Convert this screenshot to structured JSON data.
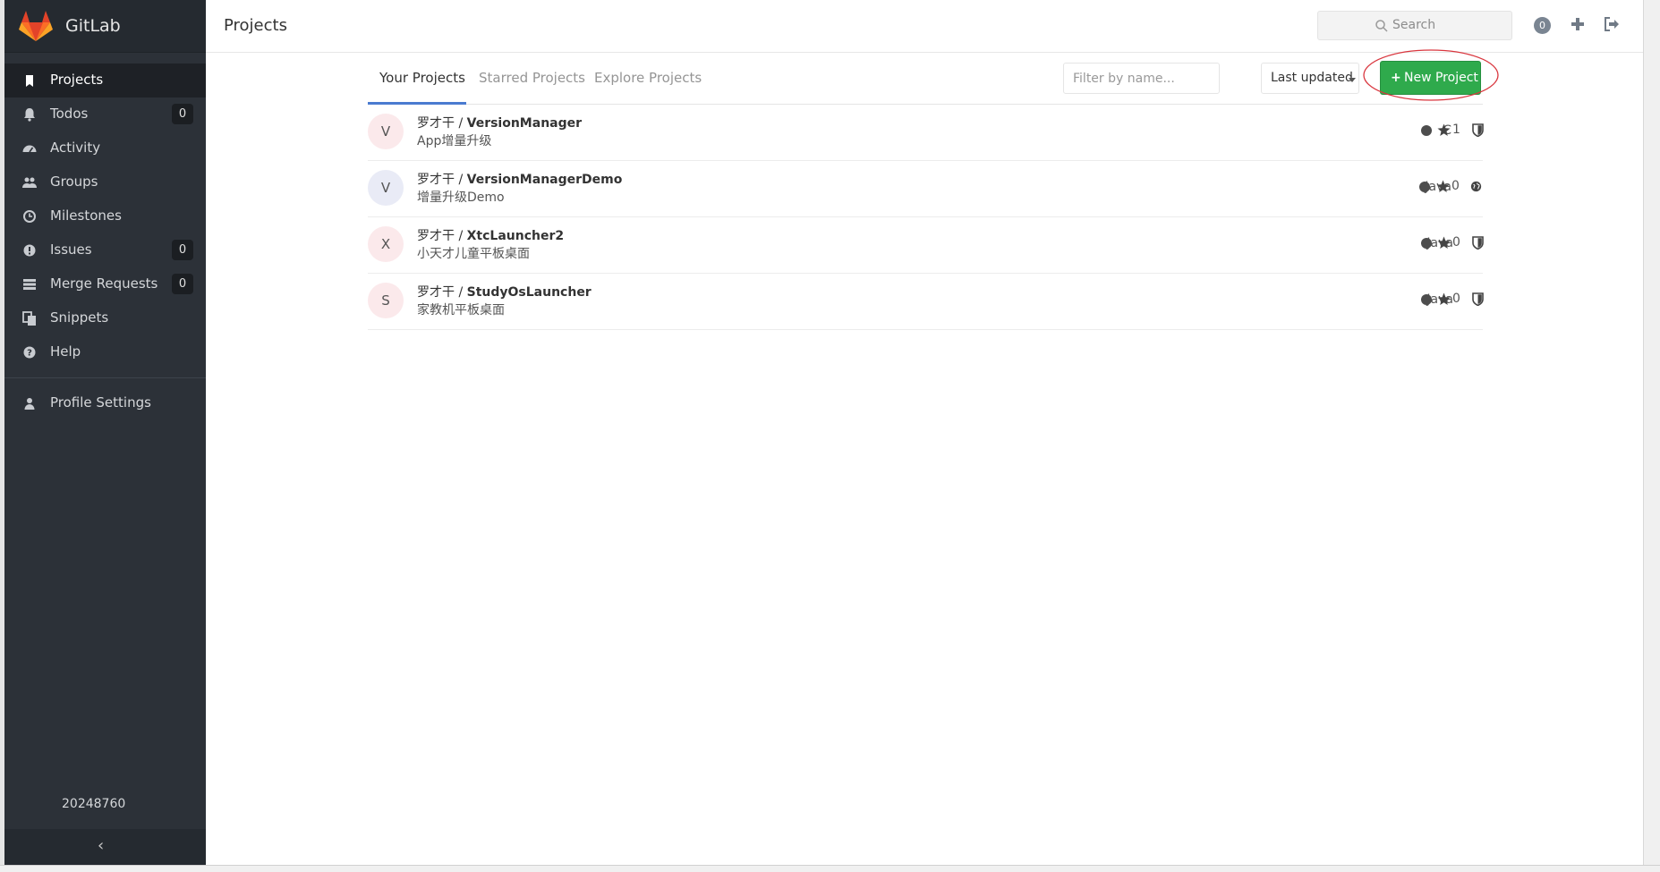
{
  "app": {
    "name": "GitLab"
  },
  "sidebar": {
    "items": [
      {
        "label": "Projects",
        "icon": "bookmark-icon",
        "active": true
      },
      {
        "label": "Todos",
        "icon": "bell-icon",
        "badge": "0"
      },
      {
        "label": "Activity",
        "icon": "dashboard-icon"
      },
      {
        "label": "Groups",
        "icon": "users-icon"
      },
      {
        "label": "Milestones",
        "icon": "clock-icon"
      },
      {
        "label": "Issues",
        "icon": "exclamation-circle-icon",
        "badge": "0"
      },
      {
        "label": "Merge Requests",
        "icon": "list-icon",
        "badge": "0"
      },
      {
        "label": "Snippets",
        "icon": "copy-icon"
      },
      {
        "label": "Help",
        "icon": "question-circle-icon"
      }
    ],
    "profile_settings": "Profile Settings",
    "user_id": "20248760",
    "collapse_icon": "‹"
  },
  "header": {
    "title": "Projects",
    "search_placeholder": "Search",
    "todo_count": "0"
  },
  "tabs": [
    {
      "label": "Your Projects",
      "active": true
    },
    {
      "label": "Starred Projects"
    },
    {
      "label": "Explore Projects"
    }
  ],
  "filter": {
    "placeholder": "Filter by name..."
  },
  "sort": {
    "label": "Last updated"
  },
  "new_project": {
    "label": "New Project",
    "plus": "+"
  },
  "projects": [
    {
      "avatar": "V",
      "namespace": "罗才干 / ",
      "name": "VersionManager",
      "description": "App增量升级",
      "language": "C",
      "stars": "1",
      "visibility": "private"
    },
    {
      "avatar": "V",
      "namespace": "罗才干 / ",
      "name": "VersionManagerDemo",
      "description": "增量升级Demo",
      "language": "Java",
      "stars": "0",
      "visibility": "public"
    },
    {
      "avatar": "X",
      "namespace": "罗才干 / ",
      "name": "XtcLauncher2",
      "description": "小天才儿童平板桌面",
      "language": "Java",
      "stars": "0",
      "visibility": "private"
    },
    {
      "avatar": "S",
      "namespace": "罗才干 / ",
      "name": "StudyOsLauncher",
      "description": "家教机平板桌面",
      "language": "Java",
      "stars": "0",
      "visibility": "private"
    }
  ],
  "colors": {
    "sidebar_bg": "#2c3138",
    "accent_green": "#2faa4c",
    "tab_underline": "#4a7bd0",
    "annotation_red": "#d9363e"
  }
}
